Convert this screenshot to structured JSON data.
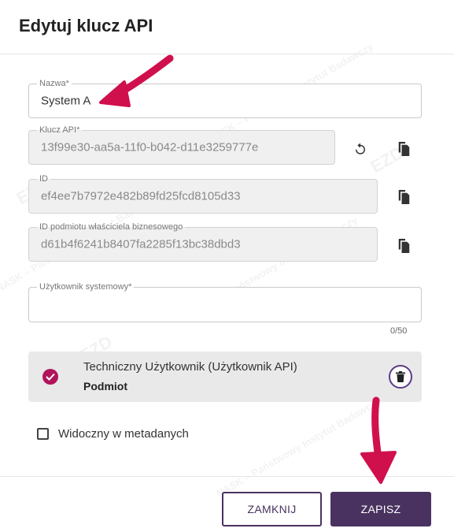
{
  "dialog": {
    "title": "Edytuj klucz API"
  },
  "fields": {
    "name": {
      "label": "Nazwa",
      "required_mark": "*",
      "value": "System A"
    },
    "api_key": {
      "label": "Klucz API",
      "required_mark": "*",
      "value": "13f99e30-aa5a-11f0-b042-d11e3259777e"
    },
    "id": {
      "label": "ID",
      "value": "ef4ee7b7972e482b89fd25fcd8105d33"
    },
    "owner_id": {
      "label": "ID podmiotu właściciela biznesowego",
      "value": "d61b4f6241b8407fa2285f13bc38dbd3"
    },
    "system_user": {
      "label": "Użytkownik systemowy",
      "required_mark": "*",
      "value": "",
      "counter": "0/50"
    }
  },
  "entity": {
    "name": "Techniczny Użytkownik (Użytkownik API)",
    "type": "Podmiot"
  },
  "metadata_checkbox": {
    "label": "Widoczny w metadanych",
    "checked": false
  },
  "buttons": {
    "close": "ZAMKNIJ",
    "save": "ZAPISZ"
  },
  "watermark": {
    "text": "NASK – Państwowy Instytut Badawczy",
    "logo": "EZD"
  },
  "icons": {
    "copy": "copy-icon",
    "regenerate": "refresh-icon",
    "delete": "trash-icon",
    "check": "check-circle-icon"
  },
  "colors": {
    "primary": "#4a3260",
    "accent": "#b0145b",
    "annotation_arrow": "#d0104c"
  }
}
